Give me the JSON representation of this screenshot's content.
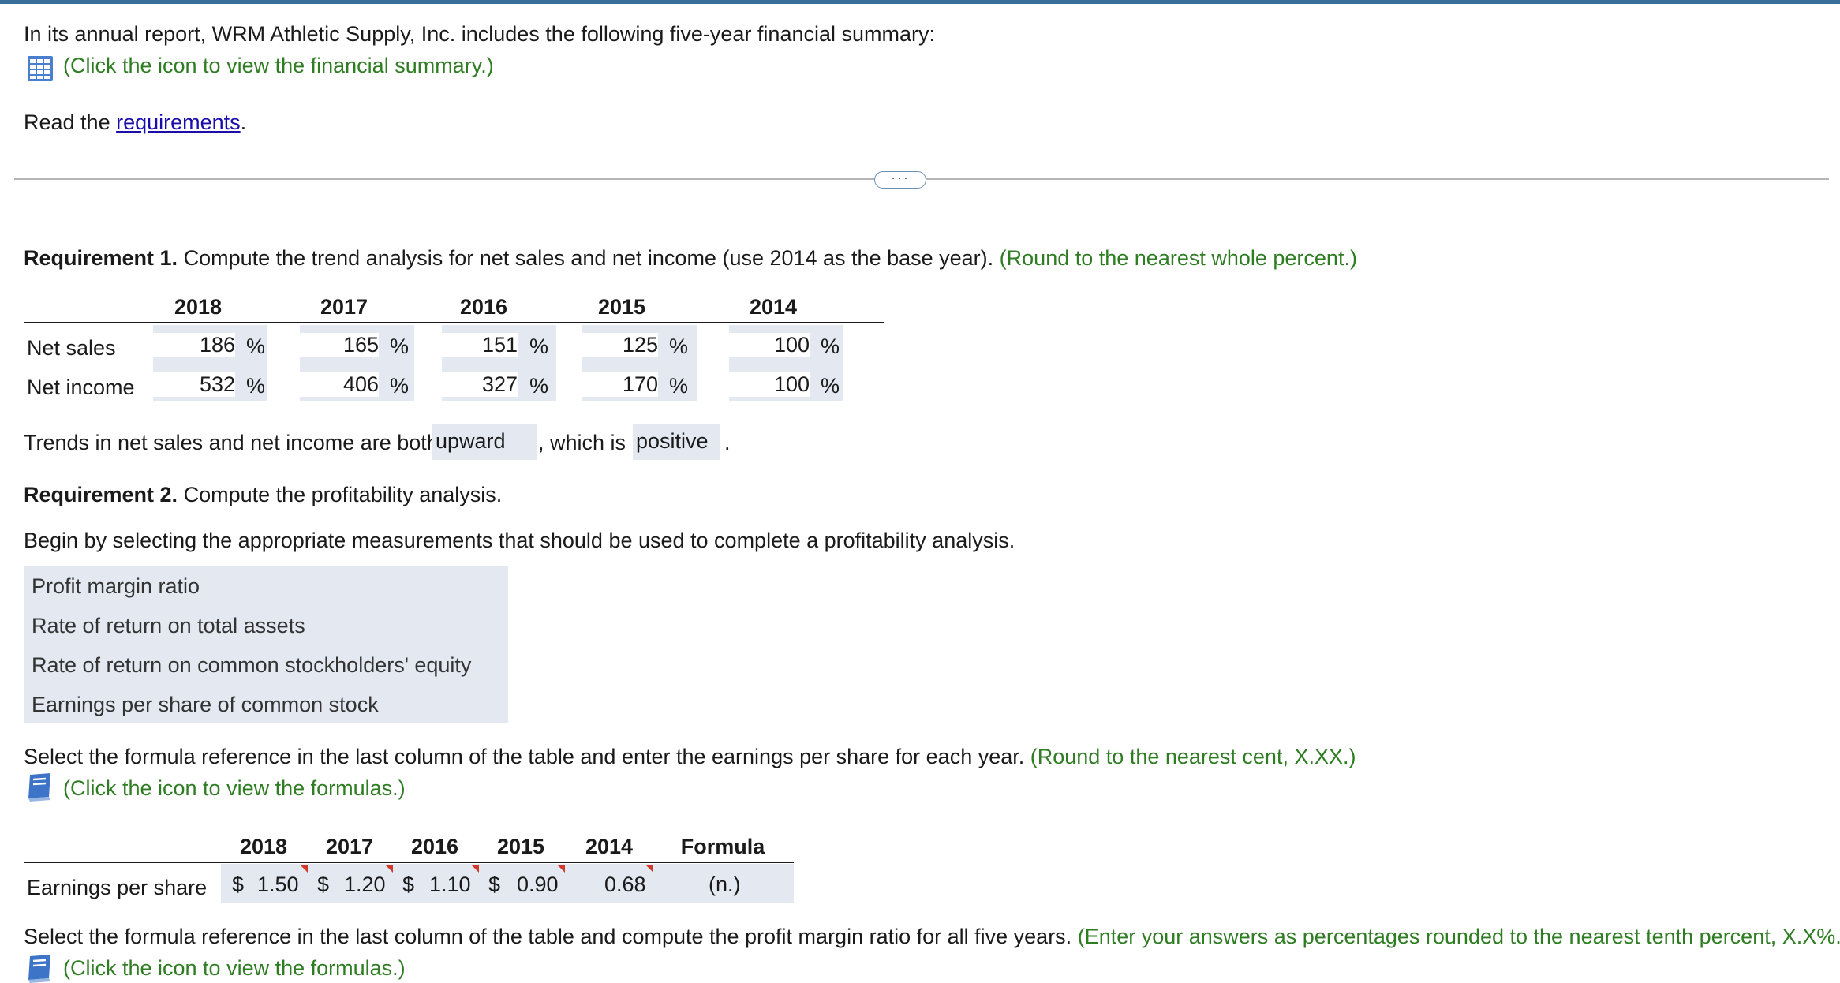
{
  "intro": {
    "text": "In its annual report, WRM Athletic Supply, Inc. includes the following five-year financial summary:",
    "summary_link": "(Click the icon to view the financial summary.)",
    "read_prefix": "Read the ",
    "requirements_link": "requirements",
    "read_suffix": "."
  },
  "req1": {
    "label": "Requirement 1.",
    "text": " Compute the trend analysis for net sales and net income (use 2014 as the base year). ",
    "hint": "(Round to the nearest whole percent.)",
    "years": [
      "2018",
      "2017",
      "2016",
      "2015",
      "2014"
    ],
    "rows": [
      {
        "label": "Net sales",
        "values": [
          "186",
          "165",
          "151",
          "125",
          "100"
        ]
      },
      {
        "label": "Net income",
        "values": [
          "532",
          "406",
          "327",
          "170",
          "100"
        ]
      }
    ],
    "pct": "%",
    "trend_prefix": "Trends in net sales and net income are both",
    "trend_value": "upward",
    "trend_middle": ", which is",
    "trend_value2": "positive",
    "trend_suffix": "."
  },
  "req2": {
    "label": "Requirement 2.",
    "text": " Compute the profitability analysis.",
    "begin": "Begin by selecting the appropriate measurements that should be used to complete a profitability analysis.",
    "measures": [
      "Profit margin ratio",
      "Rate of return on total assets",
      "Rate of return on common stockholders' equity",
      "Earnings per share of common stock"
    ],
    "eps_instruction": "Select the formula reference in the last column of the table and enter the earnings per share for each year. ",
    "eps_hint": "(Round to the nearest cent, X.XX.)",
    "formulas_link": "(Click the icon to view the formulas.)",
    "eps_table": {
      "years": [
        "2018",
        "2017",
        "2016",
        "2015",
        "2014"
      ],
      "formula_header": "Formula",
      "row_label": "Earnings per share",
      "currency": "$",
      "values": [
        "1.50",
        "1.20",
        "1.10",
        "0.90",
        "0.68"
      ],
      "formula": "(n.)"
    },
    "pm_instruction": "Select the formula reference in the last column of the table and compute the profit margin ratio for all five years. ",
    "pm_hint": "(Enter your answers as percentages rounded to the nearest tenth percent, X.X%.)",
    "formulas_link2": "(Click the icon to view the formulas.)"
  },
  "icons": {
    "summary": "table-grid-icon",
    "formulas": "book-icon",
    "divider": "ellipsis-icon"
  },
  "colors": {
    "hint_green": "#2f7d23",
    "link_blue": "#1a0dab",
    "input_bg": "#e3e8f1",
    "top_bar": "#3a6f9a",
    "flag_red": "#d03a2b"
  }
}
